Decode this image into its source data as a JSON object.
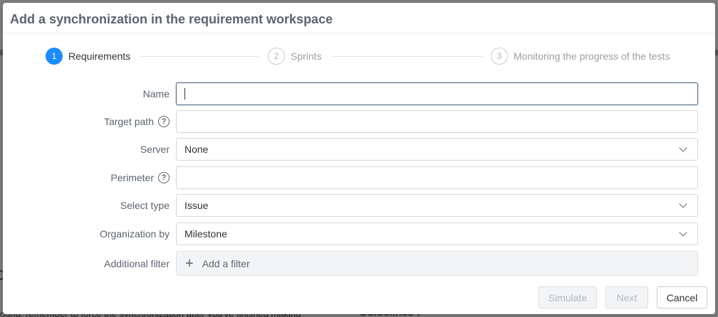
{
  "modal": {
    "title": "Add a synchronization in the requirement workspace"
  },
  "steps": [
    {
      "number": "1",
      "label": "Requirements",
      "active": true
    },
    {
      "number": "2",
      "label": "Sprints",
      "active": false
    },
    {
      "number": "3",
      "label": "Monitoring the progress of the tests",
      "active": false
    }
  ],
  "form": {
    "name_label": "Name",
    "name_value": "",
    "target_path_label": "Target path",
    "target_path_value": "",
    "server_label": "Server",
    "server_value": "None",
    "perimeter_label": "Perimeter",
    "perimeter_value": "",
    "select_type_label": "Select type",
    "select_type_value": "Issue",
    "organization_label": "Organization by",
    "organization_value": "Milestone",
    "additional_filter_label": "Additional filter",
    "add_filter_label": "Add a filter",
    "help_glyph": "?"
  },
  "footer": {
    "simulate_label": "Simulate",
    "next_label": "Next",
    "cancel_label": "Cancel"
  },
  "background": {
    "text_left": "ound, remember to force the synchronization after you've finished making",
    "text_right": "Guidelines :"
  },
  "colors": {
    "accent": "#1a8cff",
    "title": "#5b6470"
  },
  "icons": {
    "help": "question-circle-icon",
    "chevron": "chevron-down-icon",
    "plus": "plus-icon"
  }
}
